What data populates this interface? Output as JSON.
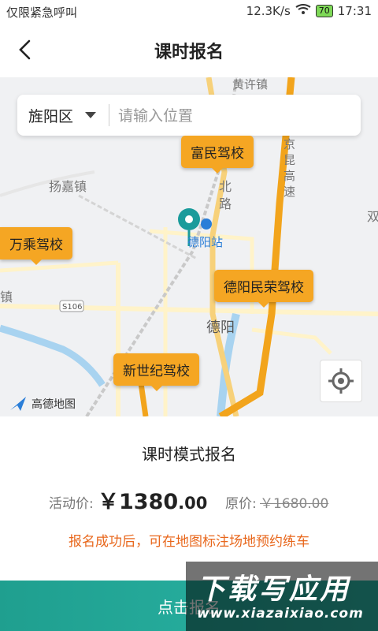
{
  "status_bar": {
    "carrier": "仅限紧急呼叫",
    "speed": "12.3K/s",
    "battery": "70",
    "time": "17:31"
  },
  "header": {
    "title": "课时报名",
    "back_icon": "chevron-left-icon"
  },
  "search": {
    "district": "旌阳区",
    "placeholder": "请输入位置"
  },
  "map": {
    "labels": {
      "town_yangjia": "扬嘉镇",
      "station": "德阳站",
      "city": "德阳",
      "road_s106": "S106",
      "road_north": "北路",
      "expressway": "京昆高速",
      "town_top": "黄许镇",
      "edge_right": "双",
      "edge_left": "镇"
    },
    "schools": [
      {
        "name": "富民驾校"
      },
      {
        "name": "万乘驾校"
      },
      {
        "name": "德阳民荣驾校"
      },
      {
        "name": "新世纪驾校"
      }
    ],
    "logo_text": "高德地图",
    "accent_color": "#f5a623"
  },
  "sheet": {
    "title": "课时模式报名",
    "activity_label": "活动价:",
    "activity_price_main": "￥1380",
    "activity_price_cents": ".00",
    "original_label": "原价:",
    "original_price": "￥1680.00",
    "notice": "报名成功后，可在地图标注场地预约练车",
    "notice_color": "#e8671c"
  },
  "submit": {
    "label": "点击报名",
    "color": "#2bb6a7"
  },
  "watermark": {
    "line1": "下载写应用",
    "line2": "www.xiazaixiao.com"
  }
}
